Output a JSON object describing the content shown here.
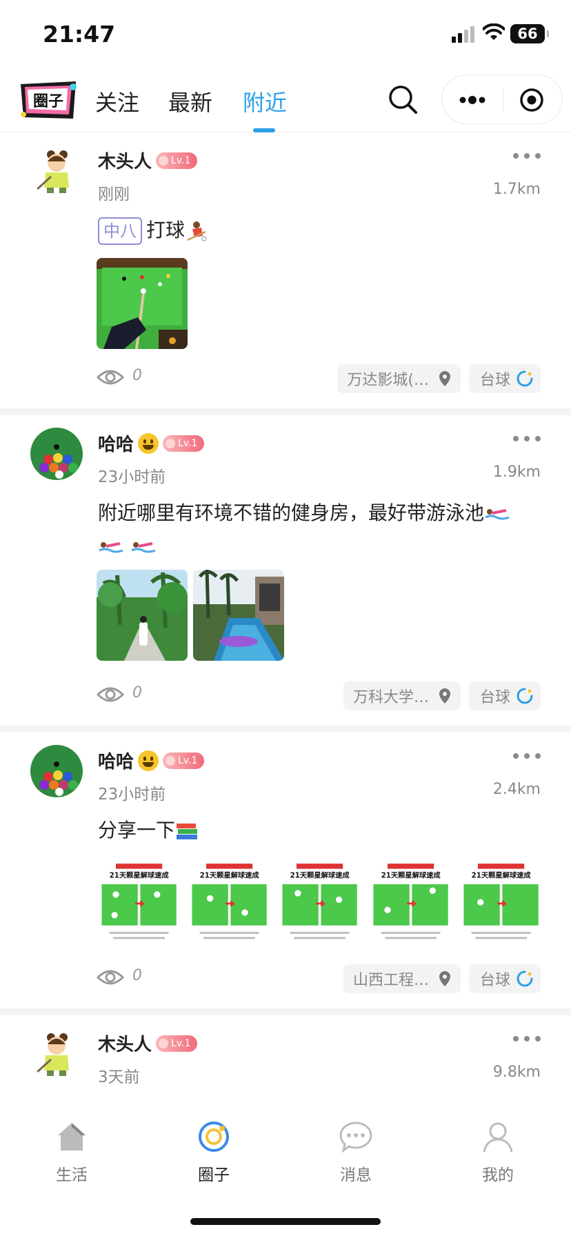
{
  "status_bar": {
    "time": "21:47",
    "battery": "66"
  },
  "nav": {
    "logo_text": "圈子",
    "tabs": [
      {
        "label": "关注"
      },
      {
        "label": "最新"
      },
      {
        "label": "附近",
        "active": true
      }
    ]
  },
  "posts": [
    {
      "username": "木头人",
      "level": "Lv.1",
      "time": "刚刚",
      "distance": "1.7km",
      "tag": "中八",
      "text": "打球",
      "views": "0",
      "location": "万达影城(…",
      "category": "台球"
    },
    {
      "username": "哈哈",
      "level": "Lv.1",
      "time": "23小时前",
      "distance": "1.9km",
      "text": "附近哪里有环境不错的健身房，最好带游泳池",
      "views": "0",
      "location": "万科大学…",
      "category": "台球"
    },
    {
      "username": "哈哈",
      "level": "Lv.1",
      "time": "23小时前",
      "distance": "2.4km",
      "text": "分享一下",
      "image_title": "21天颗星解球速成",
      "views": "0",
      "location": "山西工程…",
      "category": "台球"
    },
    {
      "username": "木头人",
      "level": "Lv.1",
      "time": "3天前",
      "distance": "9.8km"
    }
  ],
  "tabbar": [
    {
      "label": "生活",
      "icon": "home-icon"
    },
    {
      "label": "圈子",
      "icon": "circle-icon",
      "active": true
    },
    {
      "label": "消息",
      "icon": "chat-bubble-icon"
    },
    {
      "label": "我的",
      "icon": "person-icon"
    }
  ],
  "colors": {
    "accent": "#2aa0e8",
    "level_badge": "#f26a7a",
    "tag_border": "#8e8ed8"
  }
}
